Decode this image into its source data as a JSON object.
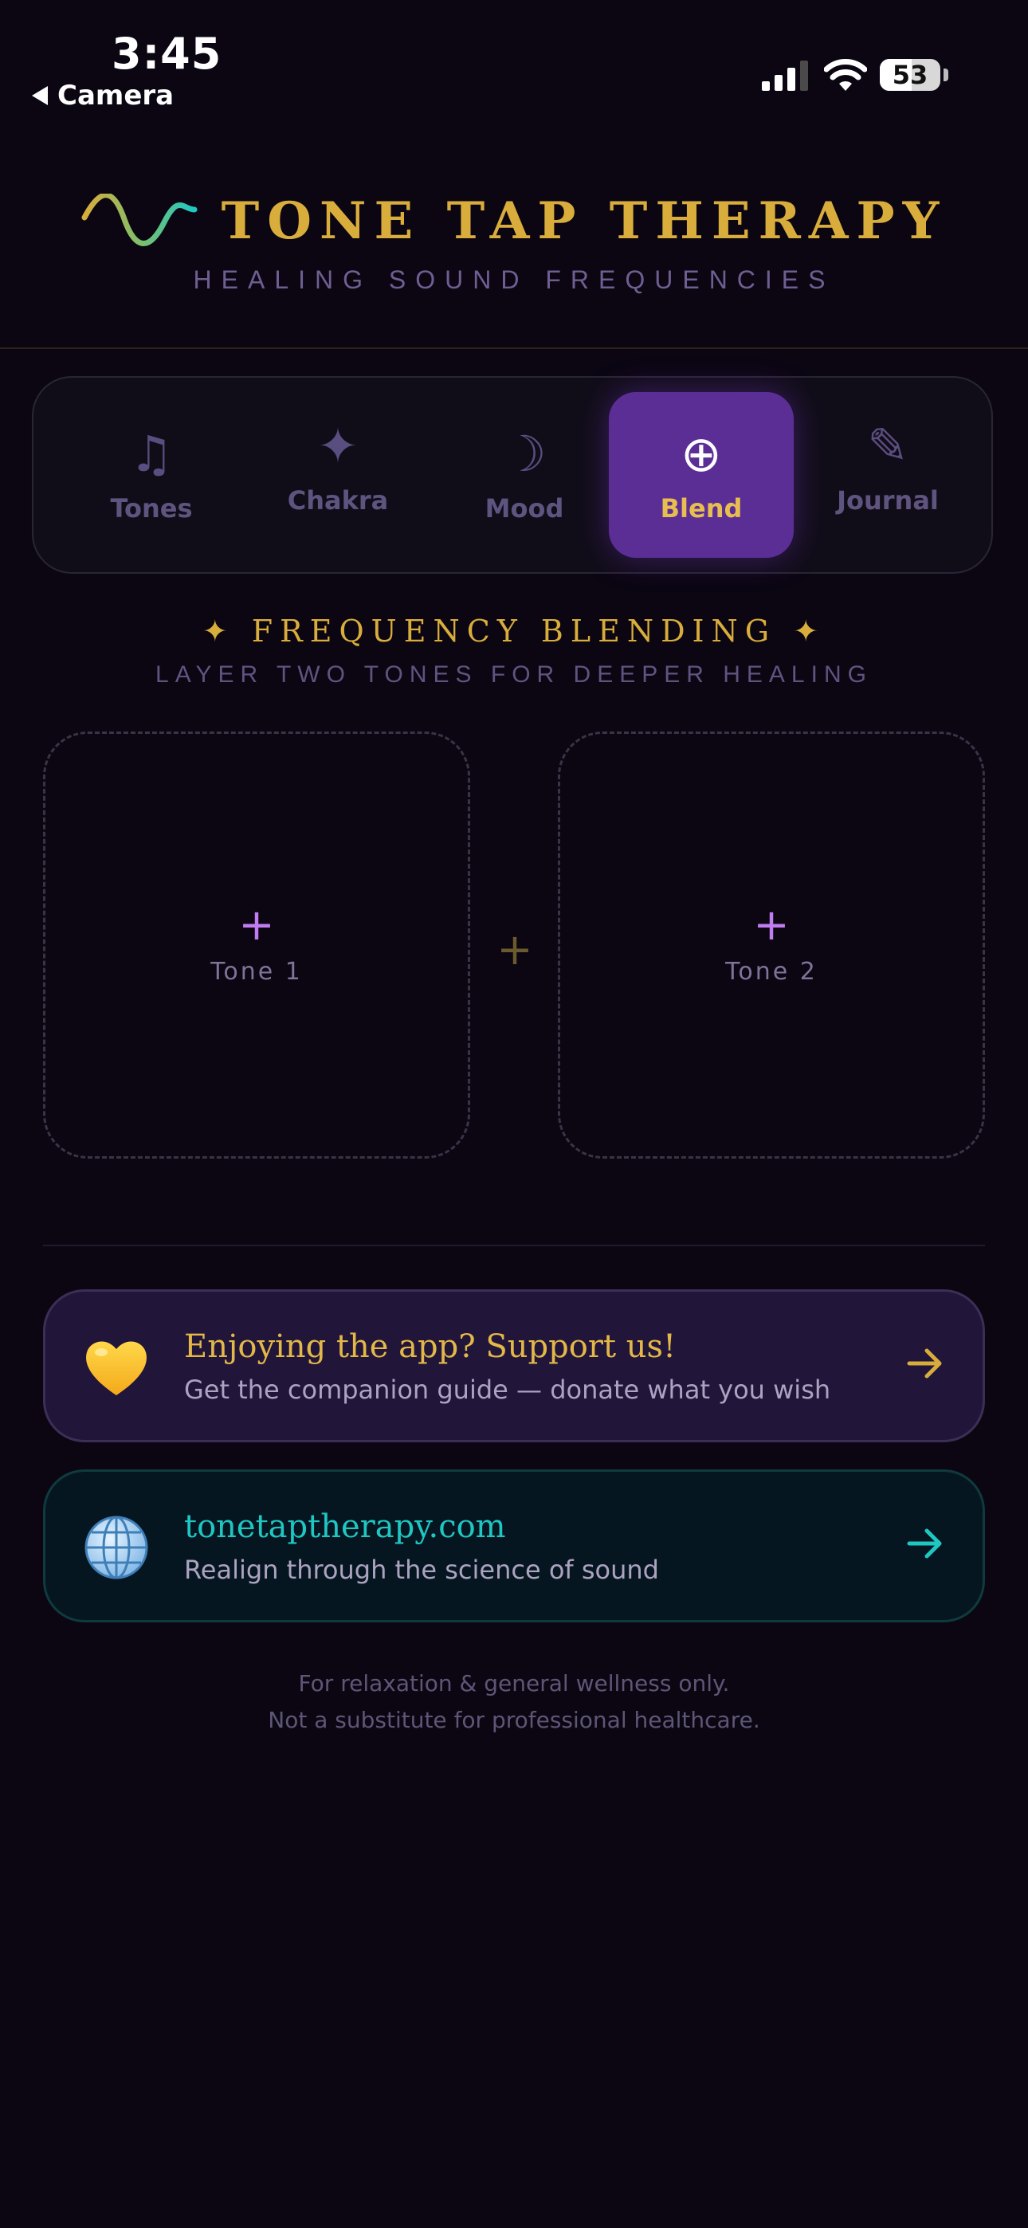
{
  "status_bar": {
    "time": "3:45",
    "back_label": "Camera",
    "battery": "53"
  },
  "header": {
    "title": "TONE TAP THERAPY",
    "subtitle": "HEALING SOUND FREQUENCIES"
  },
  "tabs": [
    {
      "label": "Tones",
      "icon": "music-note-icon",
      "glyph": "♫"
    },
    {
      "label": "Chakra",
      "icon": "sparkle-icon",
      "glyph": "✦"
    },
    {
      "label": "Mood",
      "icon": "crescent-moon-icon",
      "glyph": "☽"
    },
    {
      "label": "Blend",
      "icon": "plus-circle-icon",
      "glyph": "⊕",
      "active": true
    },
    {
      "label": "Journal",
      "icon": "pencil-icon",
      "glyph": "✎"
    }
  ],
  "section": {
    "title": "✦ FREQUENCY BLENDING ✦",
    "subtitle": "LAYER TWO TONES FOR DEEPER HEALING"
  },
  "blend": {
    "slot1": {
      "plus": "+",
      "label": "Tone 1"
    },
    "slot2": {
      "plus": "+",
      "label": "Tone 2"
    },
    "joiner": "+"
  },
  "cards": {
    "support": {
      "title": "Enjoying the app? Support us!",
      "subtitle": "Get the companion guide — donate what you wish",
      "icon": "yellow-heart-icon"
    },
    "website": {
      "title": "tonetaptherapy.com",
      "subtitle": "Realign through the science of sound",
      "icon": "globe-icon"
    }
  },
  "disclaimer": {
    "line1": "For relaxation & general wellness only.",
    "line2": "Not a substitute for professional healthcare."
  },
  "colors": {
    "background": "#0b0612",
    "gold": "#d9ad3c",
    "purple_active": "#5b2e96",
    "teal": "#1fc7c3",
    "muted_lavender": "#5f5480"
  }
}
